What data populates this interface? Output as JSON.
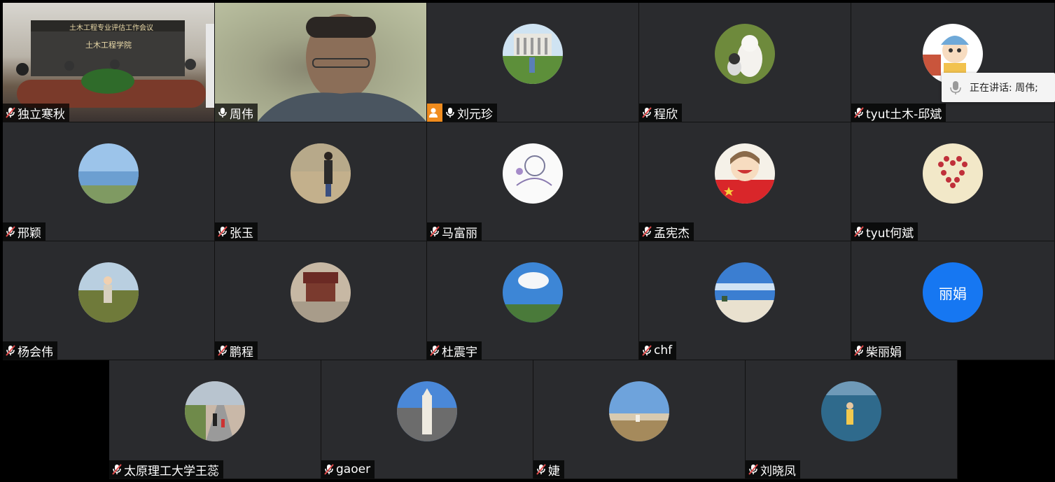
{
  "participants": [
    {
      "name": "独立寒秋",
      "avatar": "video-meeting-room",
      "mic": "muted"
    },
    {
      "name": "周伟",
      "avatar": "video-person",
      "mic": "on"
    },
    {
      "name": "刘元珍",
      "avatar": "building-photo",
      "mic": "on",
      "host": true
    },
    {
      "name": "程欣",
      "avatar": "dogs-photo",
      "mic": "muted"
    },
    {
      "name": "tyut土木-邱斌",
      "avatar": "cartoon-photo",
      "mic": "muted"
    },
    {
      "name": "邢颖",
      "avatar": "sky-lake-photo",
      "mic": "muted"
    },
    {
      "name": "张玉",
      "avatar": "woman-outdoor-photo",
      "mic": "muted"
    },
    {
      "name": "马富丽",
      "avatar": "sketch-photo",
      "mic": "muted"
    },
    {
      "name": "孟宪杰",
      "avatar": "cartoon-flag-photo",
      "mic": "muted"
    },
    {
      "name": "tyut何斌",
      "avatar": "heart-photo",
      "mic": "muted"
    },
    {
      "name": "杨会伟",
      "avatar": "child-field-photo",
      "mic": "muted"
    },
    {
      "name": "鹏程",
      "avatar": "pagoda-photo",
      "mic": "muted"
    },
    {
      "name": "杜震宇",
      "avatar": "cloud-sky-photo",
      "mic": "muted"
    },
    {
      "name": "chf",
      "avatar": "beach-photo",
      "mic": "muted"
    },
    {
      "name": "柴丽娟",
      "avatar_text": "丽娟",
      "mic": "muted"
    },
    {
      "name": "太原理工大学王蕊",
      "avatar": "path-walk-photo",
      "mic": "muted"
    },
    {
      "name": "gaoer",
      "avatar": "stupa-photo",
      "mic": "muted"
    },
    {
      "name": "婕",
      "avatar": "sunset-field-photo",
      "mic": "muted"
    },
    {
      "name": "刘晓凤",
      "avatar": "sea-photo",
      "mic": "muted"
    }
  ],
  "speaking_indicator": {
    "text": "正在讲话: 周伟;"
  },
  "video_room_banner": "土木工程专业评估工作会议",
  "video_room_logo": "土木工程学院",
  "colors": {
    "tile_bg": "#2a2b2e",
    "host_badge": "#f08c1e",
    "avatar_blue": "#1677f2",
    "muted_mic": "#e24b4b"
  }
}
